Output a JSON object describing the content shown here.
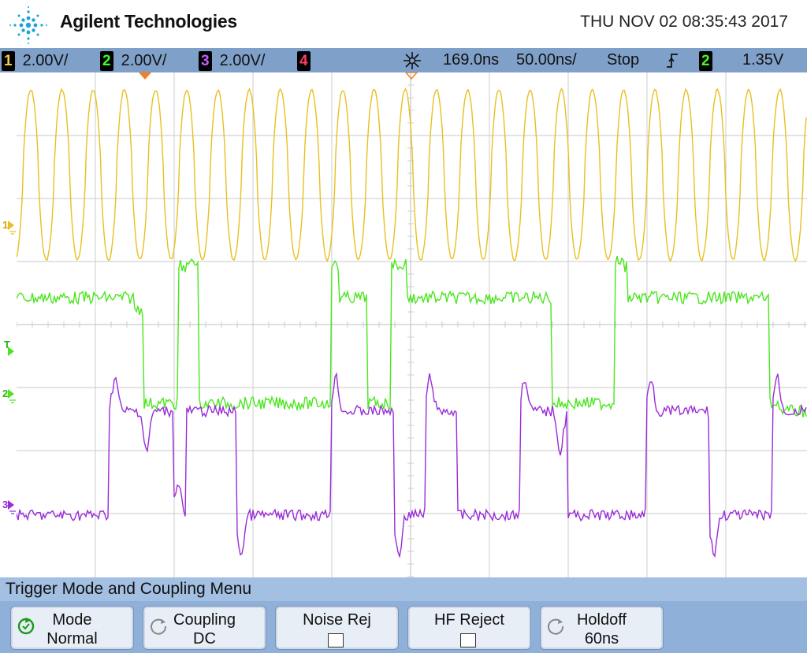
{
  "header": {
    "brand": "Agilent Technologies",
    "datetime": "THU NOV 02 08:35:43 2017"
  },
  "status_bar": {
    "channels": [
      {
        "num": "1",
        "scale": "2.00V/",
        "color": "#f4d03f"
      },
      {
        "num": "2",
        "scale": "2.00V/",
        "color": "#40ff20"
      },
      {
        "num": "3",
        "scale": "2.00V/",
        "color": "#c060ff"
      },
      {
        "num": "4",
        "scale": "",
        "color": "#ff3b6b"
      }
    ],
    "delay": "169.0ns",
    "timebase": "50.00ns/",
    "run_state": "Stop",
    "trigger_source": "2",
    "trigger_level": "1.35V"
  },
  "markers": {
    "ch1": "1",
    "trigger": "T",
    "ch2": "2",
    "ch3": "3"
  },
  "menu": {
    "title": "Trigger Mode and Coupling Menu",
    "keys": [
      {
        "line1": "Mode",
        "line2": "Normal",
        "rotary": true
      },
      {
        "line1": "Coupling",
        "line2": "DC",
        "rotary": true
      },
      {
        "line1": "Noise Rej",
        "line2": "",
        "checkbox": true
      },
      {
        "line1": "HF Reject",
        "line2": "",
        "checkbox": true
      },
      {
        "line1": "Holdoff",
        "line2": "60ns",
        "rotary": true
      }
    ]
  },
  "colors": {
    "ch1": "#e8c020",
    "ch2": "#4ae61e",
    "ch3": "#9a2cd8",
    "grid": "#c9c9c9",
    "status_bar": "#7fa0c8"
  },
  "icons": [
    "agilent-spark-logo",
    "trigger-edge-icon",
    "rotary-knob-icon",
    "delay-spark-icon"
  ]
}
